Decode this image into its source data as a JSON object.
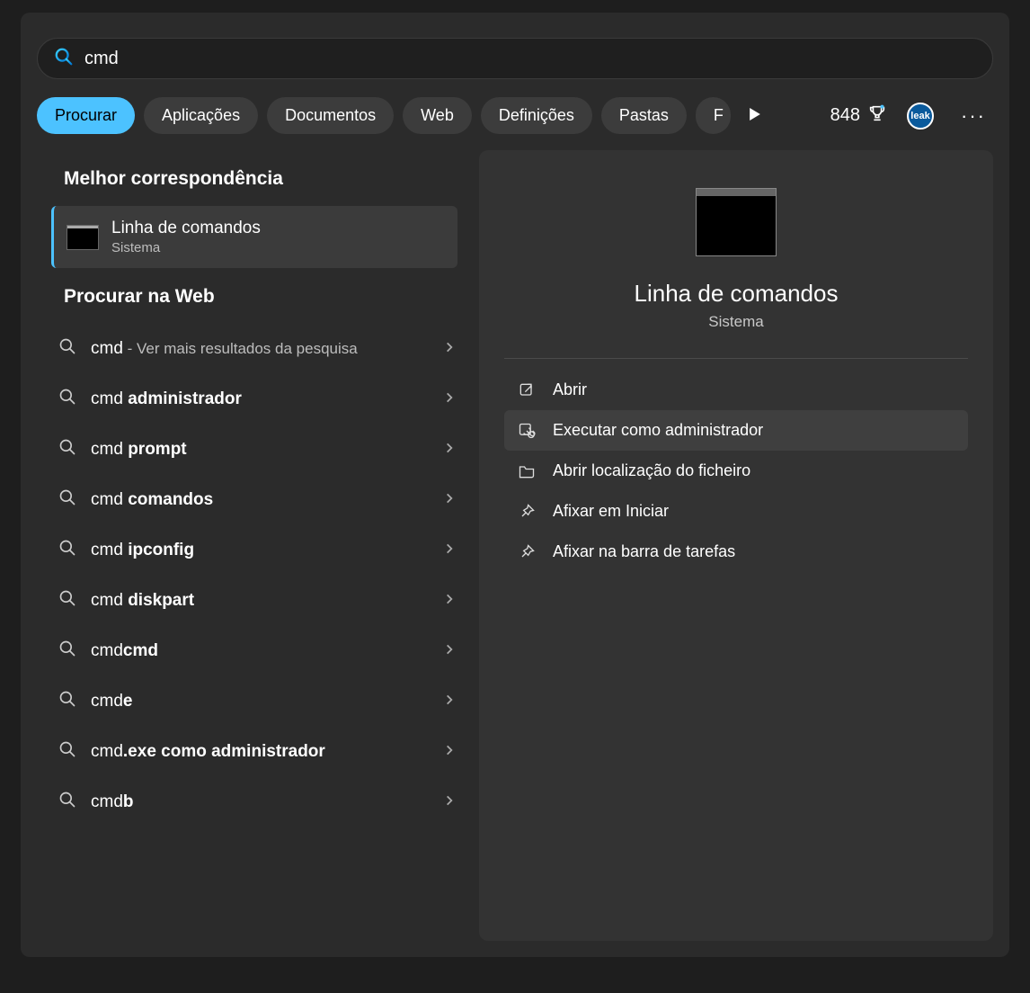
{
  "search": {
    "query": "cmd"
  },
  "filters": {
    "items": [
      {
        "label": "Procurar",
        "active": true
      },
      {
        "label": "Aplicações"
      },
      {
        "label": "Documentos"
      },
      {
        "label": "Web"
      },
      {
        "label": "Definições"
      },
      {
        "label": "Pastas"
      },
      {
        "label": "F"
      }
    ],
    "points": "848"
  },
  "left": {
    "best_header": "Melhor correspondência",
    "best": {
      "title": "Linha de comandos",
      "subtitle": "Sistema"
    },
    "web_header": "Procurar na Web",
    "web": [
      {
        "prefix": "cmd",
        "bold": "",
        "hint": " - Ver mais resultados da pesquisa"
      },
      {
        "prefix": "cmd ",
        "bold": "administrador",
        "hint": ""
      },
      {
        "prefix": "cmd ",
        "bold": "prompt",
        "hint": ""
      },
      {
        "prefix": "cmd ",
        "bold": "comandos",
        "hint": ""
      },
      {
        "prefix": "cmd ",
        "bold": "ipconfig",
        "hint": ""
      },
      {
        "prefix": "cmd ",
        "bold": "diskpart",
        "hint": ""
      },
      {
        "prefix": "cmd",
        "bold": "cmd",
        "hint": ""
      },
      {
        "prefix": "cmd",
        "bold": "e",
        "hint": ""
      },
      {
        "prefix": "cmd",
        "bold": ".exe como administrador",
        "hint": ""
      },
      {
        "prefix": "cmd",
        "bold": "b",
        "hint": ""
      }
    ]
  },
  "right": {
    "title": "Linha de comandos",
    "subtitle": "Sistema",
    "actions": [
      {
        "icon": "open",
        "label": "Abrir",
        "selected": false
      },
      {
        "icon": "admin",
        "label": "Executar como administrador",
        "selected": true
      },
      {
        "icon": "folder",
        "label": "Abrir localização do ficheiro",
        "selected": false
      },
      {
        "icon": "pin",
        "label": "Afixar em Iniciar",
        "selected": false
      },
      {
        "icon": "pin",
        "label": "Afixar na barra de tarefas",
        "selected": false
      }
    ]
  }
}
